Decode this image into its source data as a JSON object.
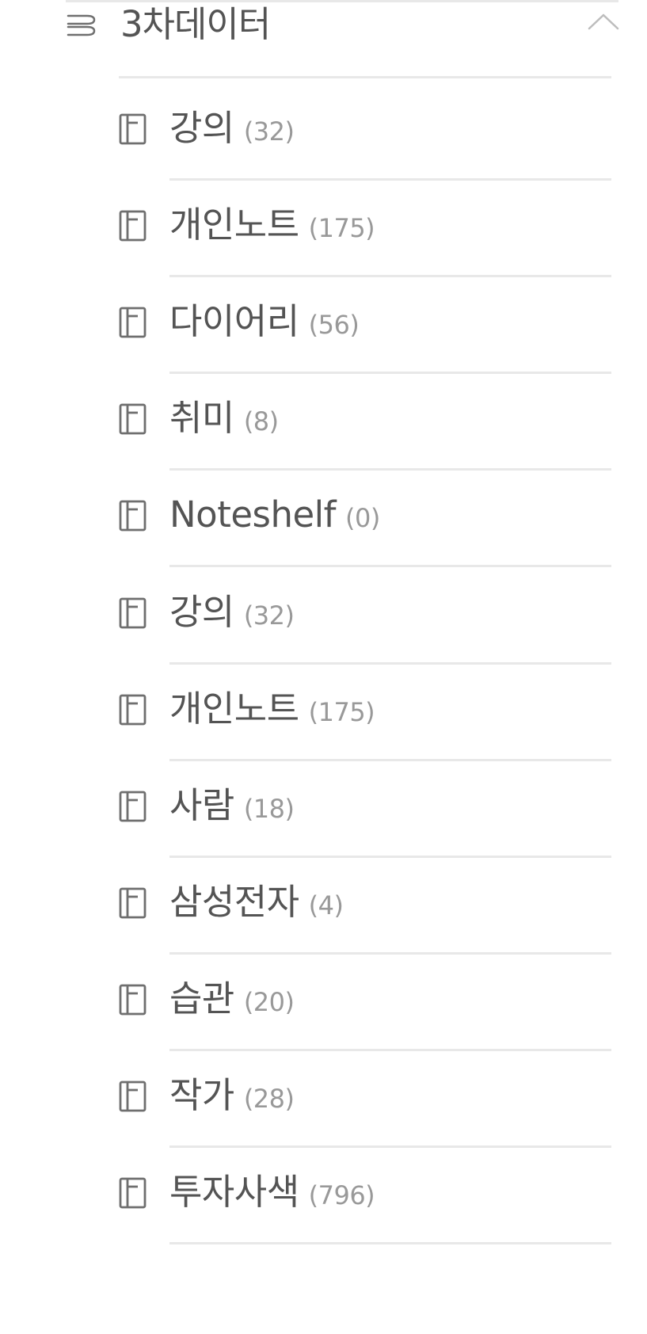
{
  "group": {
    "title": "3차데이터",
    "icon": "stack-icon",
    "expand_icon": "chevron-up-icon"
  },
  "notebooks": [
    {
      "name": "강의",
      "count": "(32)",
      "icon": "notebook-icon"
    },
    {
      "name": "개인노트",
      "count": "(175)",
      "icon": "notebook-icon"
    },
    {
      "name": "다이어리",
      "count": "(56)",
      "icon": "notebook-icon"
    },
    {
      "name": "취미",
      "count": "(8)",
      "icon": "notebook-icon"
    },
    {
      "name": "Noteshelf",
      "count": "(0)",
      "icon": "notebook-icon"
    },
    {
      "name": "강의",
      "count": "(32)",
      "icon": "notebook-icon"
    },
    {
      "name": "개인노트",
      "count": "(175)",
      "icon": "notebook-icon"
    },
    {
      "name": "사람",
      "count": "(18)",
      "icon": "notebook-icon"
    },
    {
      "name": "삼성전자",
      "count": "(4)",
      "icon": "notebook-icon"
    },
    {
      "name": "습관",
      "count": "(20)",
      "icon": "notebook-icon"
    },
    {
      "name": "작가",
      "count": "(28)",
      "icon": "notebook-icon"
    },
    {
      "name": "투자사색",
      "count": "(796)",
      "icon": "notebook-icon"
    }
  ],
  "colors": {
    "text": "#545454",
    "count": "#999999",
    "divider": "#e8e8e8",
    "icon": "#6f6f6f",
    "chevron": "#bdbdbd"
  }
}
